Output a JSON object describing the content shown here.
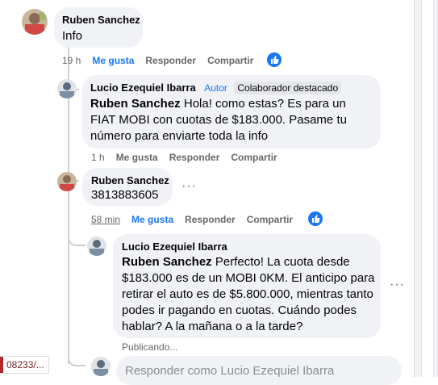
{
  "comments": [
    {
      "author": "Ruben Sanchez",
      "text": "Info",
      "time": "19 h",
      "like": "Me gusta",
      "reply": "Responder",
      "share": "Compartir"
    },
    {
      "author": "Lucio Ezequiel Ibarra",
      "author_tag": "Autor",
      "badge": "Colaborador destacado",
      "mention": "Ruben Sanchez",
      "text": "Hola! como estas? Es para un FIAT MOBI con cuotas de $183.000. Pasame tu número para enviarte toda la info",
      "time": "1 h",
      "like": "Me gusta",
      "reply": "Responder",
      "share": "Compartir"
    },
    {
      "author": "Ruben Sanchez",
      "text": "3813883605",
      "time": "58 min",
      "like": "Me gusta",
      "reply": "Responder",
      "share": "Compartir"
    },
    {
      "author": "Lucio Ezequiel Ibarra",
      "mention": "Ruben Sanchez",
      "text": "Perfecto! La cuota desde $183.000 es de un MOBI 0KM. El anticipo para retirar el auto es de $5.800.000, mientras tanto podes ir pagando en cuotas. Cuándo podes hablar? A la mañana o a la tarde?",
      "status": "Publicando..."
    }
  ],
  "reply_box": {
    "placeholder": "Responder como Lucio Ezequiel Ibarra"
  },
  "status_bar": {
    "url_fragment": "08233/..."
  },
  "icons": [
    "like-thumb-icon",
    "more-dots-icon"
  ],
  "colors": {
    "accent": "#1877f2",
    "bubble": "#f0f2f5",
    "secondary_text": "#65676b"
  }
}
